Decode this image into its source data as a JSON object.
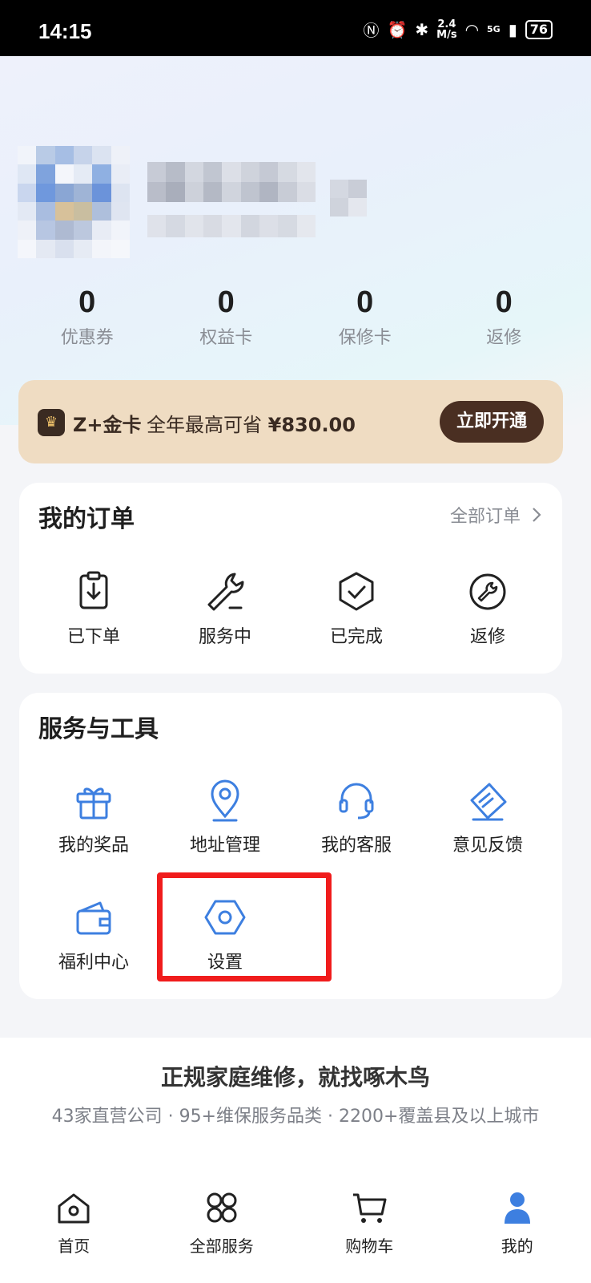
{
  "status_bar": {
    "time": "14:15",
    "net_speed_value": "2.4",
    "net_speed_unit": "M/s",
    "signal": "5G",
    "battery": "76"
  },
  "stats": [
    {
      "value": "0",
      "label": "优惠券"
    },
    {
      "value": "0",
      "label": "权益卡"
    },
    {
      "value": "0",
      "label": "保修卡"
    },
    {
      "value": "0",
      "label": "返修"
    }
  ],
  "gold_card": {
    "title": "Z+金卡",
    "desc_prefix": "全年最高可省",
    "amount": "¥830.00",
    "button": "立即开通"
  },
  "orders": {
    "title": "我的订单",
    "more": "全部订单",
    "items": [
      {
        "label": "已下单",
        "icon": "clipboard-download-icon"
      },
      {
        "label": "服务中",
        "icon": "wrench-icon"
      },
      {
        "label": "已完成",
        "icon": "shield-check-icon"
      },
      {
        "label": "返修",
        "icon": "repair-circle-icon"
      }
    ]
  },
  "tools": {
    "title": "服务与工具",
    "items": [
      {
        "label": "我的奖品",
        "icon": "gift-icon"
      },
      {
        "label": "地址管理",
        "icon": "location-pin-icon"
      },
      {
        "label": "我的客服",
        "icon": "headset-icon"
      },
      {
        "label": "意见反馈",
        "icon": "feedback-icon"
      },
      {
        "label": "福利中心",
        "icon": "wallet-icon"
      },
      {
        "label": "设置",
        "icon": "settings-hex-icon"
      }
    ]
  },
  "promo": {
    "slogan": "正规家庭维修，就找啄木鸟",
    "sub": "43家直营公司 · 95+维保服务品类 · 2200+覆盖县及以上城市"
  },
  "tabbar": [
    {
      "label": "首页",
      "icon": "home-icon"
    },
    {
      "label": "全部服务",
      "icon": "grid-services-icon"
    },
    {
      "label": "购物车",
      "icon": "cart-icon"
    },
    {
      "label": "我的",
      "icon": "profile-icon"
    }
  ],
  "colors": {
    "accent_blue": "#3d7fe0",
    "gold_bg": "#efdcc2",
    "gold_btn": "#4a2f22",
    "highlight_red": "#f01c1c"
  }
}
